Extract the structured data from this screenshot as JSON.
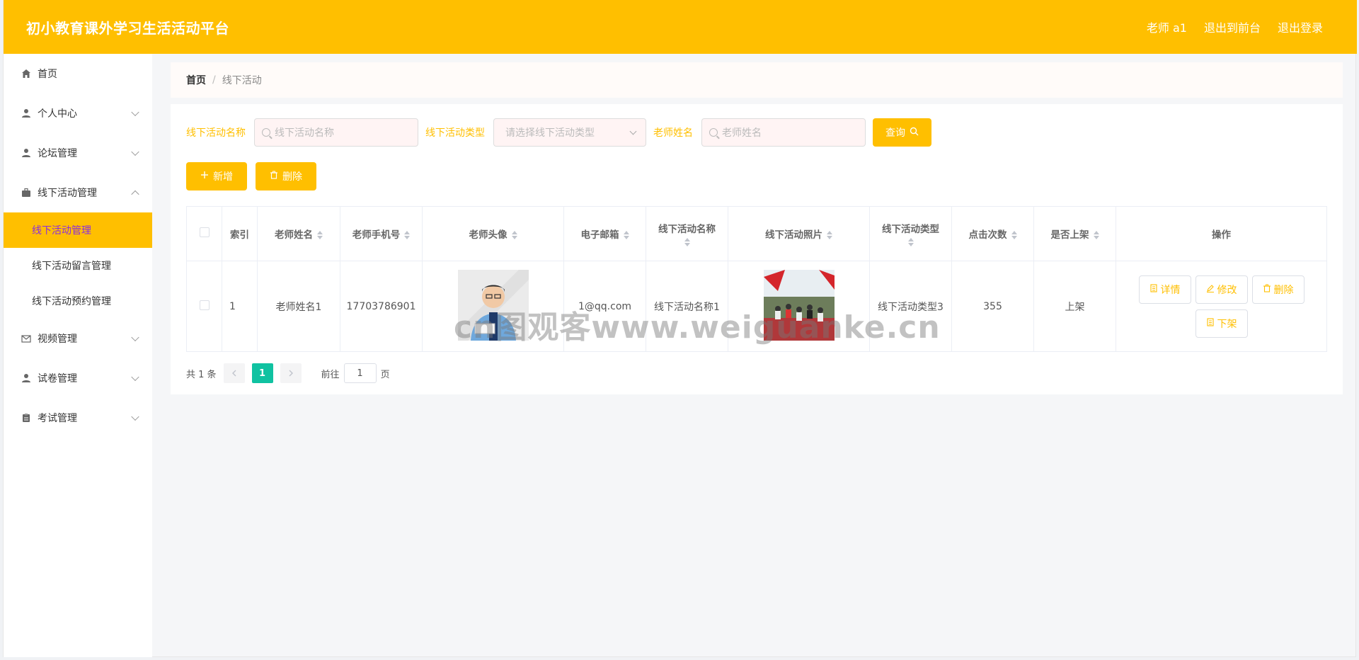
{
  "header": {
    "title": "初小教育课外学习生活活动平台",
    "user": "老师 a1",
    "back_front": "退出到前台",
    "logout": "退出登录"
  },
  "sidebar": {
    "items": [
      {
        "label": "首页",
        "icon": "home-icon"
      },
      {
        "label": "个人中心",
        "icon": "user-icon"
      },
      {
        "label": "论坛管理",
        "icon": "user-icon"
      },
      {
        "label": "线下活动管理",
        "icon": "briefcase-icon"
      },
      {
        "label": "视频管理",
        "icon": "mail-icon"
      },
      {
        "label": "试卷管理",
        "icon": "user-icon"
      },
      {
        "label": "考试管理",
        "icon": "clipboard-icon"
      }
    ],
    "sub_items": [
      "线下活动管理",
      "线下活动留言管理",
      "线下活动预约管理"
    ]
  },
  "breadcrumb": {
    "home": "首页",
    "sep": "/",
    "current": "线下活动"
  },
  "filters": {
    "name_label": "线下活动名称",
    "name_placeholder": "线下活动名称",
    "type_label": "线下活动类型",
    "type_placeholder": "请选择线下活动类型",
    "teacher_label": "老师姓名",
    "teacher_placeholder": "老师姓名",
    "search_btn": "查询"
  },
  "actions": {
    "add": "新增",
    "delete": "删除"
  },
  "table": {
    "headers": [
      "索引",
      "老师姓名",
      "老师手机号",
      "老师头像",
      "电子邮箱",
      "线下活动名称",
      "线下活动照片",
      "线下活动类型",
      "点击次数",
      "是否上架",
      "操作"
    ],
    "rows": [
      {
        "index": "1",
        "teacher_name": "老师姓名1",
        "phone": "17703786901",
        "email": "1@qq.com",
        "activity_name": "线下活动名称1",
        "activity_type": "线下活动类型3",
        "clicks": "355",
        "on_shelf": "上架",
        "ops": {
          "detail": "详情",
          "edit": "修改",
          "delete": "删除",
          "off": "下架"
        }
      }
    ]
  },
  "pager": {
    "total": "共 1 条",
    "current": "1",
    "goto_label": "前往",
    "goto_value": "1",
    "page_unit": "页"
  },
  "watermark": "cn图观客www.weiguanke.cn",
  "colors": {
    "accent": "#ffbf00",
    "pager_active": "#10c2a1",
    "submenu_active_text": "#8a2be2"
  }
}
